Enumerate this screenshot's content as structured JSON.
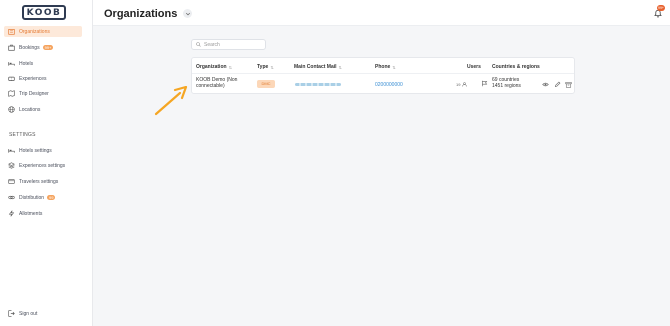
{
  "app": {
    "logo": "KOOB"
  },
  "sidebar": {
    "items": [
      {
        "label": "Organizations",
        "icon": "building-icon",
        "active": true
      },
      {
        "label": "Bookings",
        "icon": "briefcase-icon",
        "badge": "99+"
      },
      {
        "label": "Hotels",
        "icon": "bed-icon"
      },
      {
        "label": "Experiences",
        "icon": "ticket-icon"
      },
      {
        "label": "Trip Designer",
        "icon": "map-icon"
      },
      {
        "label": "Locations",
        "icon": "globe-icon"
      }
    ],
    "settings_label": "SETTINGS",
    "settings_items": [
      {
        "label": "Hotels settings",
        "icon": "bed-icon"
      },
      {
        "label": "Experiences settings",
        "icon": "layers-icon"
      },
      {
        "label": "Travelers settings",
        "icon": "card-icon"
      },
      {
        "label": "Distribution",
        "icon": "link-icon",
        "badge": "99"
      },
      {
        "label": "Allotments",
        "icon": "bolt-icon"
      }
    ],
    "sign_out": "Sign out"
  },
  "header": {
    "title": "Organizations",
    "notification_badge": "99+"
  },
  "search": {
    "placeholder": "Search"
  },
  "table": {
    "columns": [
      "Organization",
      "Type",
      "Main Contact Mail",
      "Phone",
      "Users",
      "Countries & regions"
    ],
    "rows": [
      {
        "organization": "KOOB Demo (Non connectable)",
        "type": "DMC",
        "phone": "0200000000",
        "users": "19",
        "countries": "69 countries",
        "regions": "1451 regions"
      }
    ]
  },
  "colors": {
    "accent": "#f5a35d",
    "active_bg": "#fde9da",
    "arrow": "#f5a623",
    "link": "#3b8fd4"
  }
}
